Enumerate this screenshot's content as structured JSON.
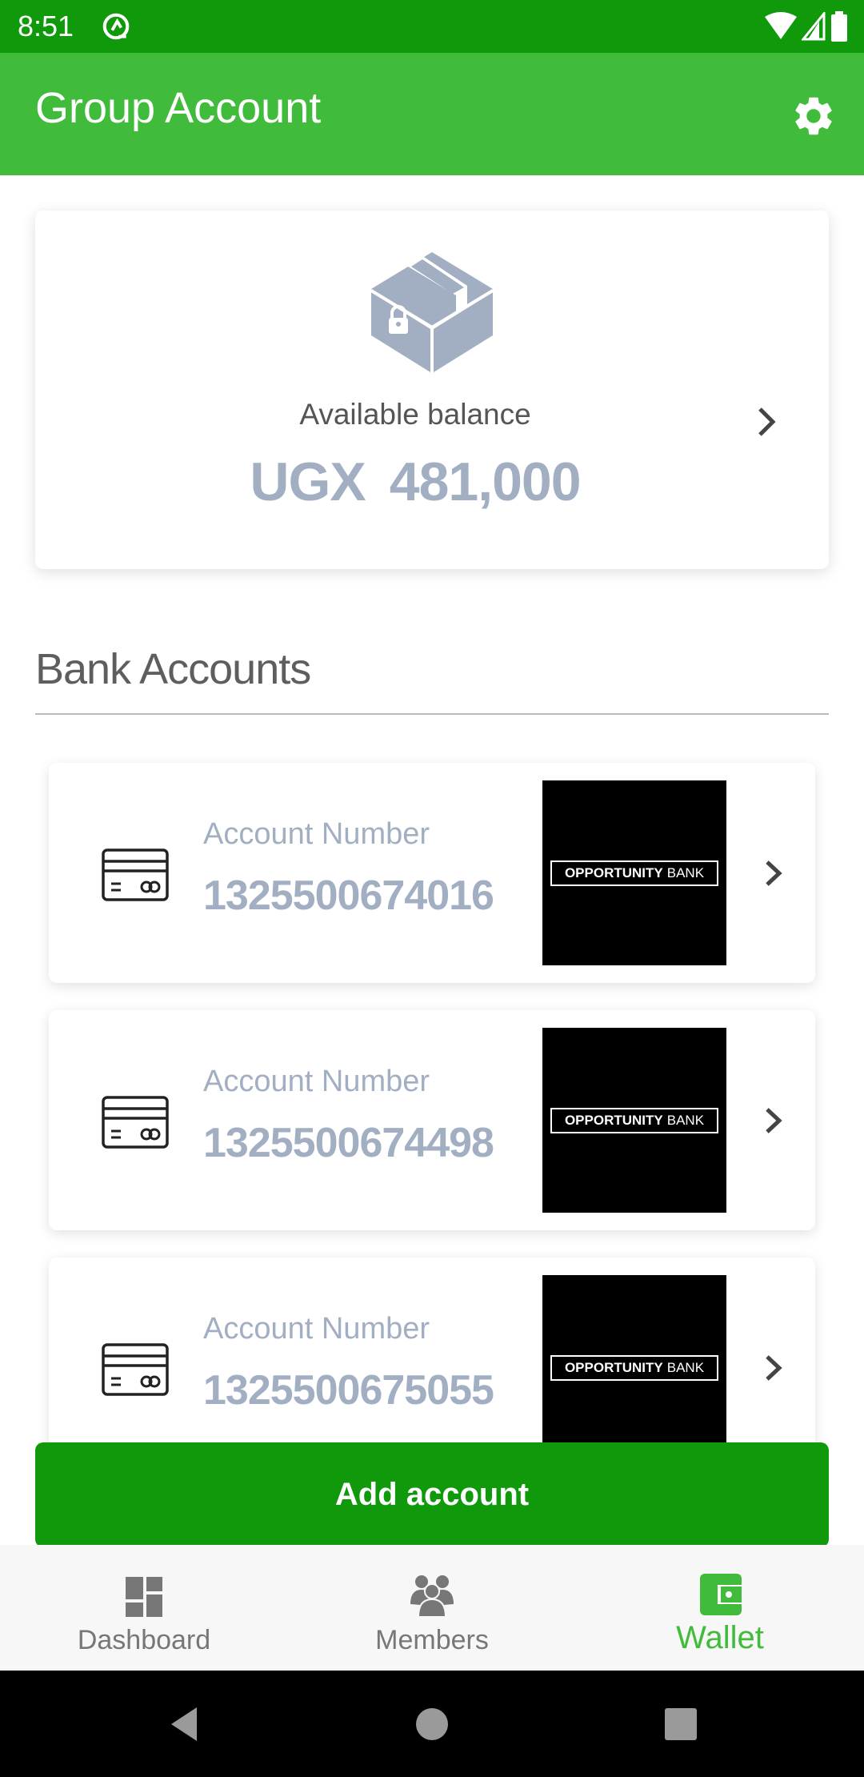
{
  "status_bar": {
    "time": "8:51",
    "notification_icon": "at-sign-icon",
    "icons": [
      "wifi-icon",
      "signal-icon",
      "battery-icon"
    ]
  },
  "app_bar": {
    "title": "Group Account",
    "settings_icon": "gear-icon"
  },
  "balance": {
    "label": "Available balance",
    "currency": "UGX",
    "amount": "481,000",
    "icon": "locked-box-icon"
  },
  "section": {
    "title": "Bank Accounts"
  },
  "accounts": [
    {
      "label": "Account Number",
      "number": "1325500674016",
      "bank_bold": "OPPORTUNITY",
      "bank_light": "BANK"
    },
    {
      "label": "Account Number",
      "number": "1325500674498",
      "bank_bold": "OPPORTUNITY",
      "bank_light": "BANK"
    },
    {
      "label": "Account Number",
      "number": "1325500675055",
      "bank_bold": "OPPORTUNITY",
      "bank_light": "BANK"
    }
  ],
  "add_button": {
    "label": "Add account"
  },
  "bottom_nav": {
    "items": [
      {
        "label": "Dashboard",
        "icon": "dashboard-icon",
        "active": false
      },
      {
        "label": "Members",
        "icon": "members-icon",
        "active": false
      },
      {
        "label": "Wallet",
        "icon": "wallet-icon",
        "active": true
      }
    ]
  },
  "colors": {
    "primary_dark": "#0f990b",
    "primary": "#41bb3b",
    "muted_blue": "#a2afc2"
  }
}
